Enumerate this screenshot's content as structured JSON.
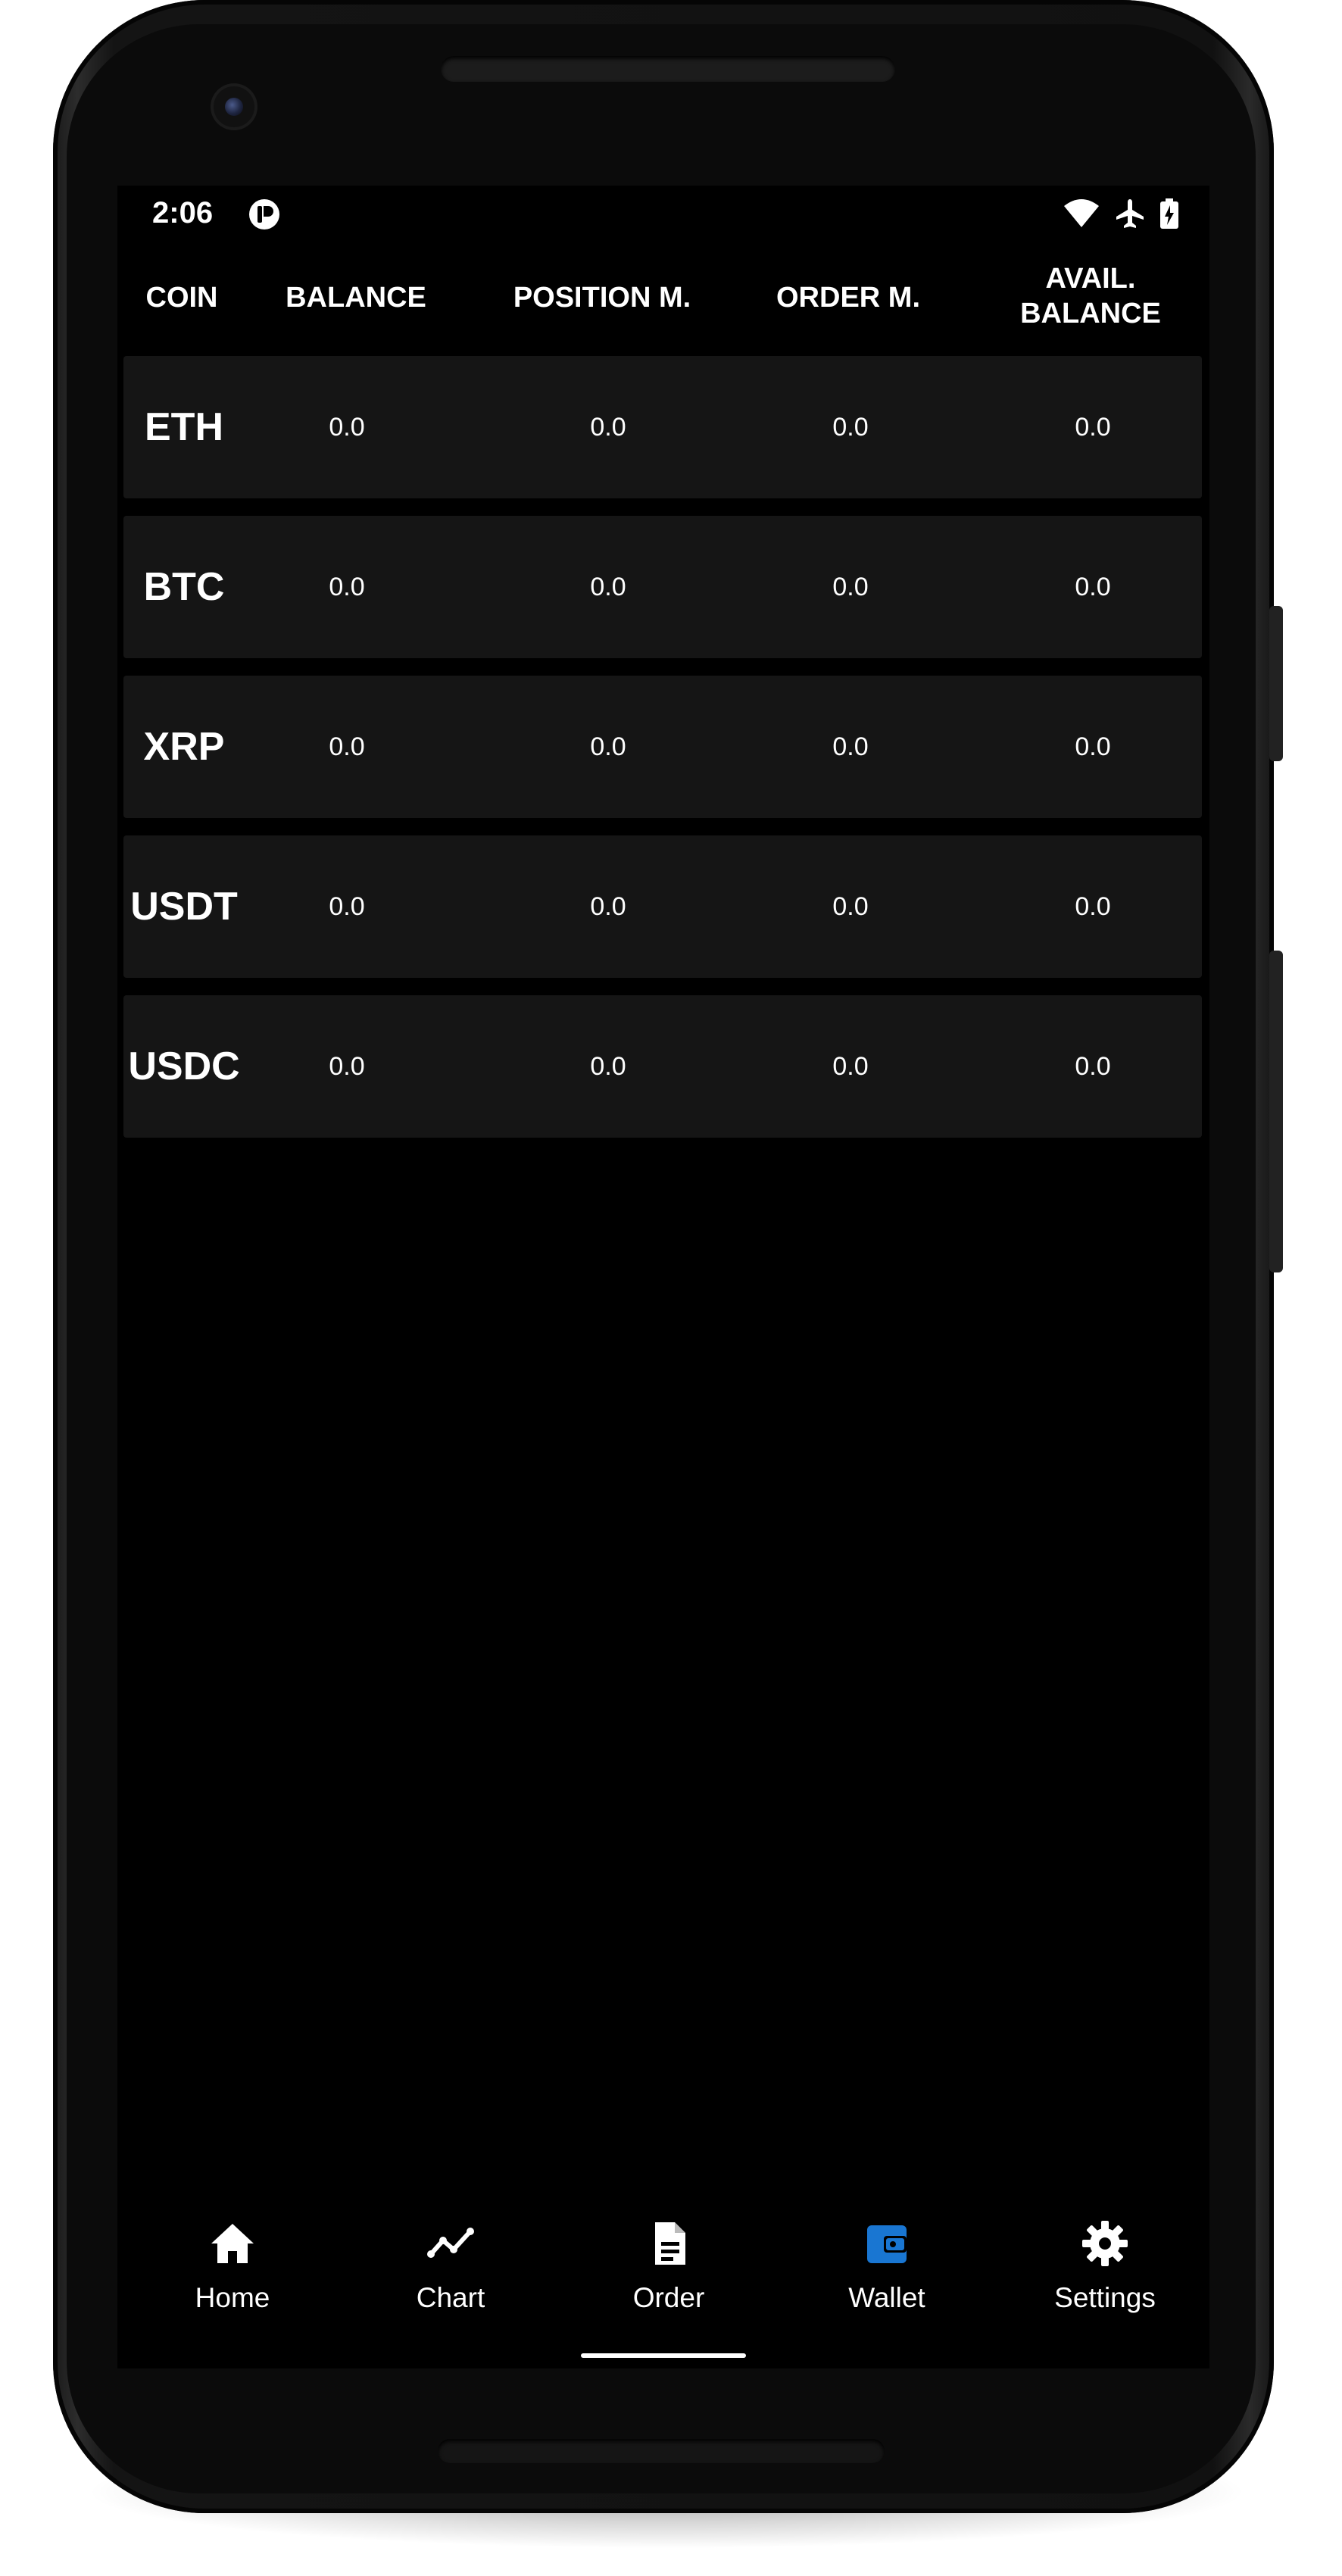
{
  "status_bar": {
    "time": "2:06",
    "icons": [
      "assistant-icon",
      "wifi-icon",
      "airplane-icon",
      "battery-charging-icon"
    ]
  },
  "table": {
    "headers": {
      "coin": "COIN",
      "balance": "BALANCE",
      "position_margin": "POSITION M.",
      "order_margin": "ORDER M.",
      "avail_balance": "AVAIL. BALANCE"
    },
    "rows": [
      {
        "coin": "ETH",
        "balance": "0.0",
        "position_margin": "0.0",
        "order_margin": "0.0",
        "avail_balance": "0.0"
      },
      {
        "coin": "BTC",
        "balance": "0.0",
        "position_margin": "0.0",
        "order_margin": "0.0",
        "avail_balance": "0.0"
      },
      {
        "coin": "XRP",
        "balance": "0.0",
        "position_margin": "0.0",
        "order_margin": "0.0",
        "avail_balance": "0.0"
      },
      {
        "coin": "USDT",
        "balance": "0.0",
        "position_margin": "0.0",
        "order_margin": "0.0",
        "avail_balance": "0.0"
      },
      {
        "coin": "USDC",
        "balance": "0.0",
        "position_margin": "0.0",
        "order_margin": "0.0",
        "avail_balance": "0.0"
      }
    ]
  },
  "bottom_nav": {
    "items": [
      {
        "label": "Home",
        "icon": "home-icon"
      },
      {
        "label": "Chart",
        "icon": "chart-line-icon"
      },
      {
        "label": "Order",
        "icon": "document-icon"
      },
      {
        "label": "Wallet",
        "icon": "wallet-icon",
        "active": true
      },
      {
        "label": "Settings",
        "icon": "gear-icon"
      }
    ],
    "active_color": "#1976D2",
    "inactive_color": "#FFFFFF"
  },
  "colors": {
    "background": "#000000",
    "row_background": "#151515",
    "text": "#FFFFFF",
    "accent": "#1976D2"
  }
}
